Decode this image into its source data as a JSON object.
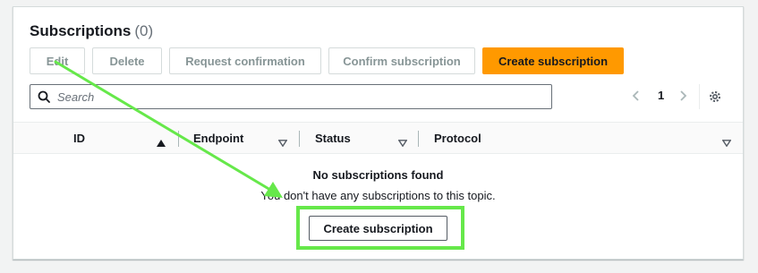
{
  "header": {
    "title": "Subscriptions",
    "count": "(0)"
  },
  "toolbar": {
    "edit_label": "Edit",
    "delete_label": "Delete",
    "request_label": "Request confirmation",
    "confirm_label": "Confirm subscription",
    "create_label": "Create subscription"
  },
  "search": {
    "placeholder": "Search",
    "value": ""
  },
  "pagination": {
    "current_page": "1"
  },
  "table": {
    "columns": [
      "ID",
      "Endpoint",
      "Status",
      "Protocol"
    ]
  },
  "empty_state": {
    "title": "No subscriptions found",
    "message": "You don't have any subscriptions to this topic.",
    "button_label": "Create subscription"
  },
  "colors": {
    "primary_button": "#ff9900",
    "annotation": "#66e84a",
    "background": "#f2f3f3"
  },
  "icons": [
    "search-icon",
    "chevron-left-icon",
    "chevron-right-icon",
    "settings-gear-icon",
    "sort-ascending-icon",
    "sort-down-icon"
  ]
}
